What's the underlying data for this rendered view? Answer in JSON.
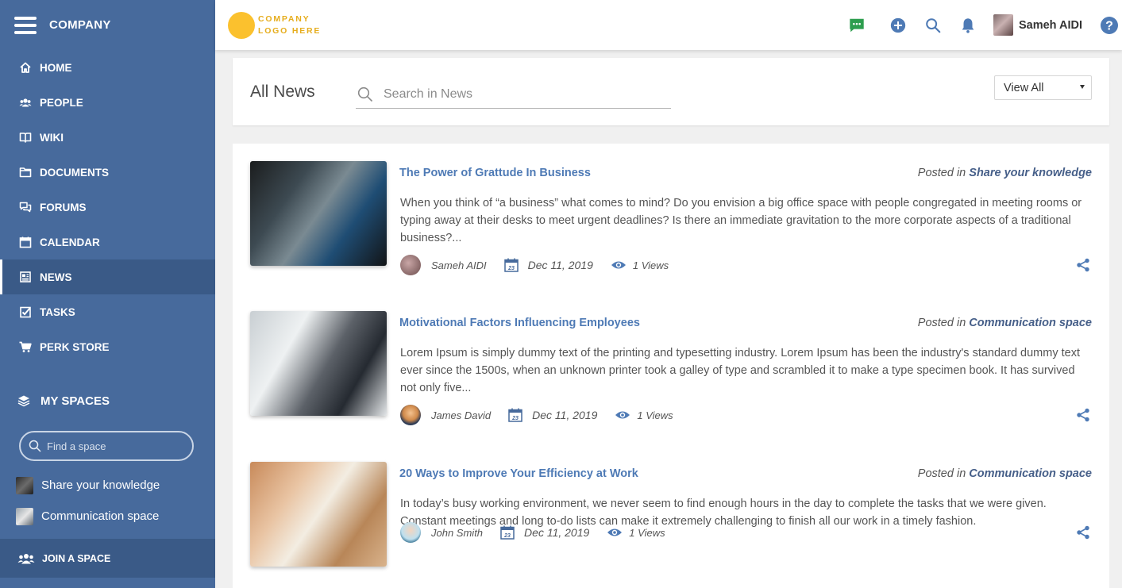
{
  "sidebar": {
    "brand": "COMPANY",
    "nav": [
      {
        "label": "HOME",
        "icon": "home-icon"
      },
      {
        "label": "PEOPLE",
        "icon": "people-icon"
      },
      {
        "label": "WIKI",
        "icon": "book-icon"
      },
      {
        "label": "DOCUMENTS",
        "icon": "folder-icon"
      },
      {
        "label": "FORUMS",
        "icon": "forum-icon"
      },
      {
        "label": "CALENDAR",
        "icon": "calendar-icon"
      },
      {
        "label": "NEWS",
        "icon": "news-icon",
        "active": true
      },
      {
        "label": "TASKS",
        "icon": "tasks-icon"
      },
      {
        "label": "PERK STORE",
        "icon": "cart-icon"
      }
    ],
    "my_spaces_label": "MY SPACES",
    "find_space_placeholder": "Find a space",
    "spaces": [
      {
        "label": "Share your knowledge"
      },
      {
        "label": "Communication space"
      }
    ],
    "join_space_label": "JOIN A SPACE"
  },
  "topbar": {
    "logo_line1": "COMPANY",
    "logo_line2": "LOGO HERE",
    "user_name": "Sameh AIDI",
    "icons": [
      "chat-icon",
      "add-icon",
      "search-icon",
      "bell-icon",
      "help-icon"
    ]
  },
  "header": {
    "title": "All News",
    "search_placeholder": "Search in News",
    "filter_value": "View All"
  },
  "news": [
    {
      "title": "The Power of Grattude In Business",
      "posted_in_label": "Posted in",
      "space": "Share your knowledge",
      "excerpt": "When you think of “a business” what comes to mind?  Do you envision a big office space with people congregated in meeting rooms or typing away at their desks to meet urgent deadlines? Is there an immediate gravitation to the more corporate aspects of a traditional business?...",
      "author": "Sameh AIDI",
      "date": "Dec 11, 2019",
      "views": "1 Views"
    },
    {
      "title": "Motivational Factors Influencing Employees",
      "posted_in_label": "Posted in",
      "space": "Communication space",
      "excerpt": "Lorem Ipsum is simply dummy text of the printing and typesetting industry. Lorem Ipsum has been the industry's standard dummy text ever since the 1500s, when an unknown printer took a galley of type and scrambled it to make a type specimen book. It has survived not only five...",
      "author": "James David",
      "date": "Dec 11, 2019",
      "views": "1 Views"
    },
    {
      "title": "20 Ways to Improve Your Efficiency at Work",
      "posted_in_label": "Posted in",
      "space": "Communication space",
      "excerpt": "In today’s busy working environment, we never seem to find enough hours in the day to complete the tasks that we were given. Constant meetings and long to-do lists can make it extremely challenging to finish all our work in a timely fashion.",
      "author": "John Smith",
      "date": "Dec 11, 2019",
      "views": "1 Views"
    }
  ],
  "colors": {
    "sidebar_bg": "#476a9c",
    "sidebar_active": "#3a5a87",
    "link_blue": "#4e7ab5",
    "logo_yellow": "#fbc12e",
    "chat_green": "#2e9e4f"
  }
}
